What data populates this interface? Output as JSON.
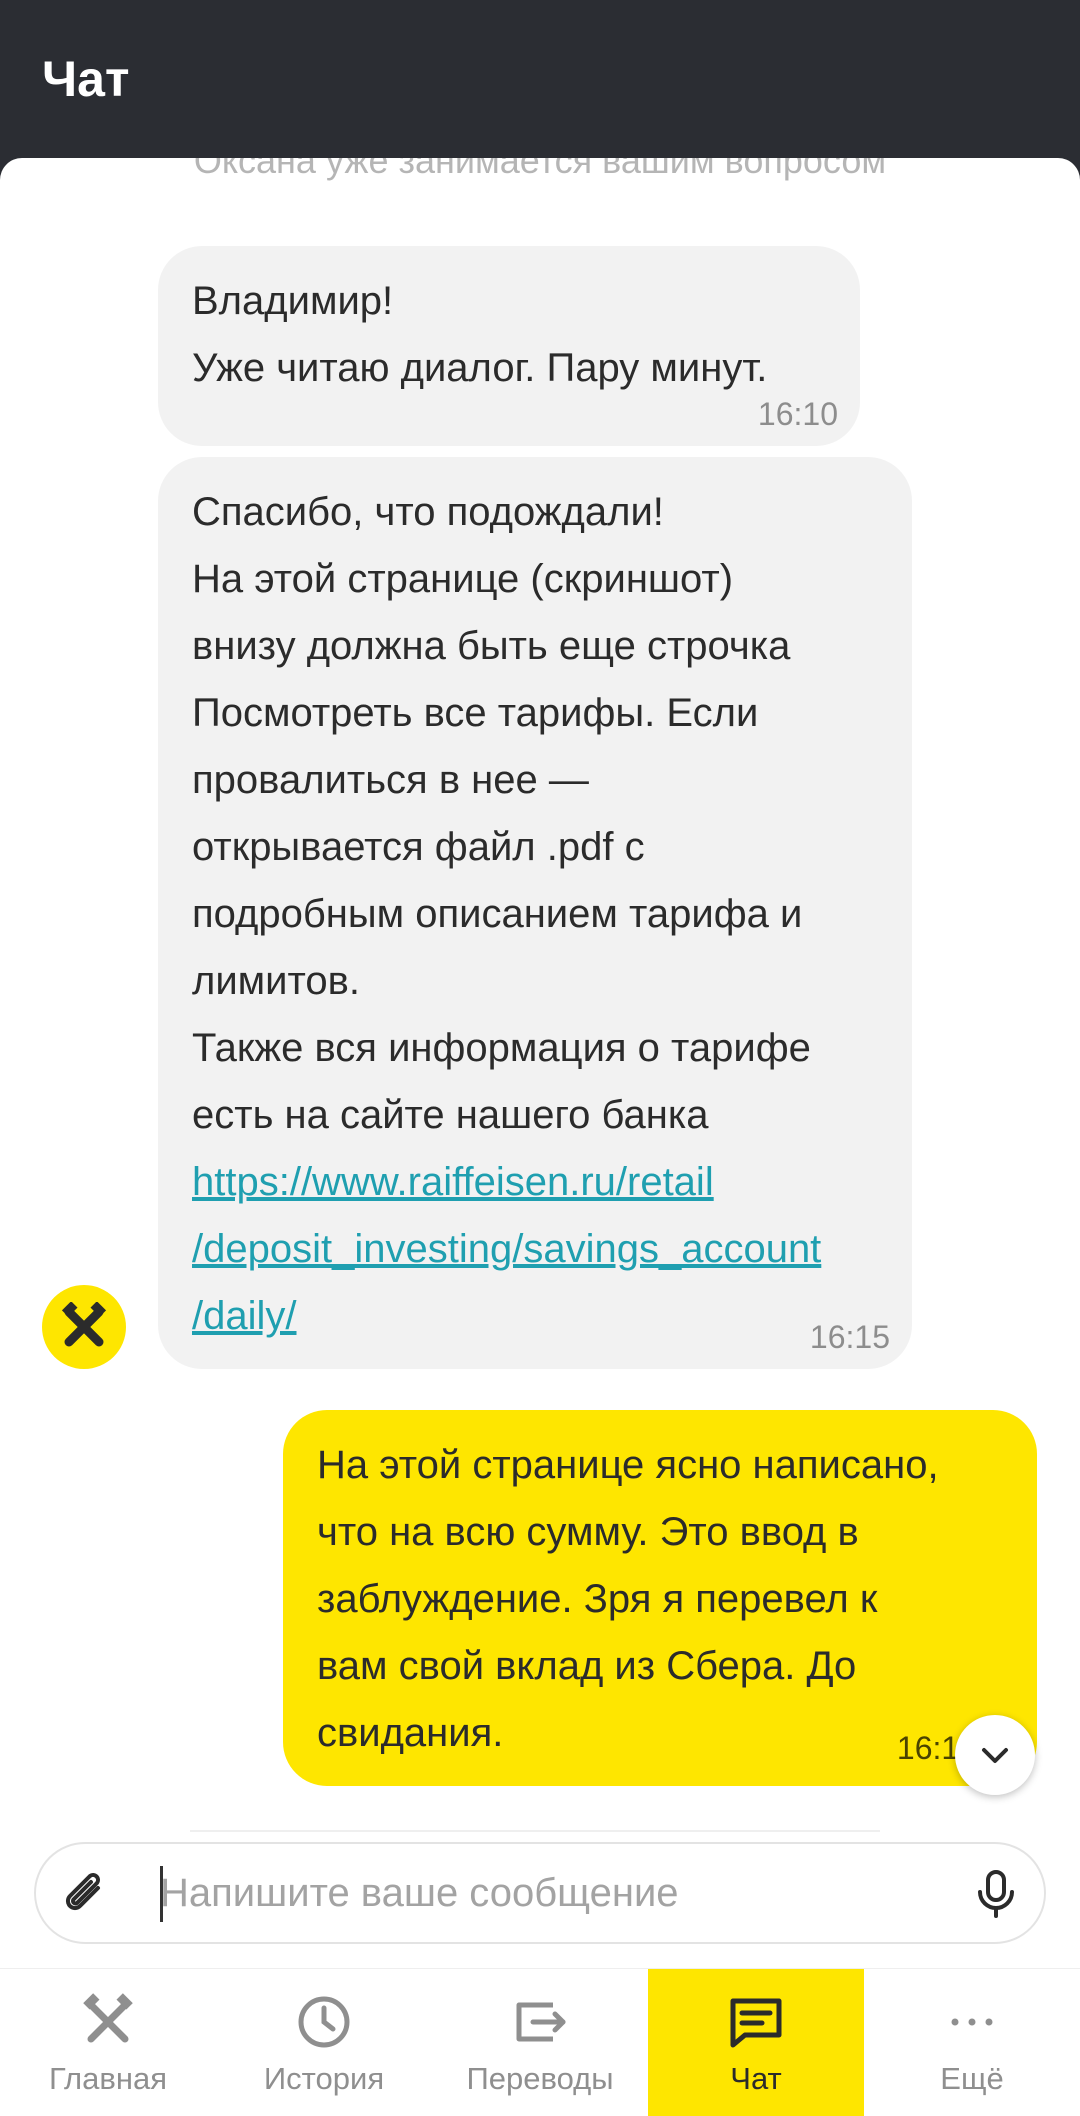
{
  "header": {
    "title": "Чат"
  },
  "chat": {
    "system_note": "Оксана уже занимается вашим вопросом",
    "messages": [
      {
        "direction": "incoming",
        "lines": [
          "Владимир!",
          "Уже читаю диалог. Пару минут."
        ],
        "time": "16:10"
      },
      {
        "direction": "incoming",
        "lines": [
          "Спасибо, что подождали!",
          "На этой странице (скриншот)",
          "внизу должна быть еще строчка",
          "Посмотреть все тарифы. Если",
          "провалиться в нее  —",
          "открывается файл .pdf с",
          "подробным описанием тарифа и",
          "лимитов.",
          "Также вся информация о тарифе",
          "есть на сайте нашего банка"
        ],
        "link_lines": [
          "https://www.raiffeisen.ru/retail",
          "/deposit_investing/savings_account",
          "/daily/"
        ],
        "time": "16:15"
      },
      {
        "direction": "outgoing",
        "lines": [
          "На этой странице ясно написано,",
          "что на всю сумму. Это ввод в",
          "заблуждение. Зря я перевел к",
          "вам свой вклад из Сбера. До",
          "свидания."
        ],
        "time": "16:17"
      }
    ],
    "bot_avatar_icon": "raiffeisen-logo-icon",
    "scroll_down_icon": "chevron-down-icon"
  },
  "composer": {
    "placeholder": "Напишите ваше сообщение",
    "value": "",
    "attach_icon": "paperclip-icon",
    "mic_icon": "microphone-icon"
  },
  "tabbar": {
    "items": [
      {
        "label": "Главная",
        "icon": "home-logo-icon",
        "active": false
      },
      {
        "label": "История",
        "icon": "clock-icon",
        "active": false
      },
      {
        "label": "Переводы",
        "icon": "transfer-icon",
        "active": false
      },
      {
        "label": "Чат",
        "icon": "chat-icon",
        "active": true
      },
      {
        "label": "Ещё",
        "icon": "more-dots-icon",
        "active": false
      }
    ]
  },
  "colors": {
    "accent": "#fee600",
    "header_bg": "#2b2d33",
    "incoming_bubble": "#f2f2f2",
    "link": "#1f9fb0"
  }
}
